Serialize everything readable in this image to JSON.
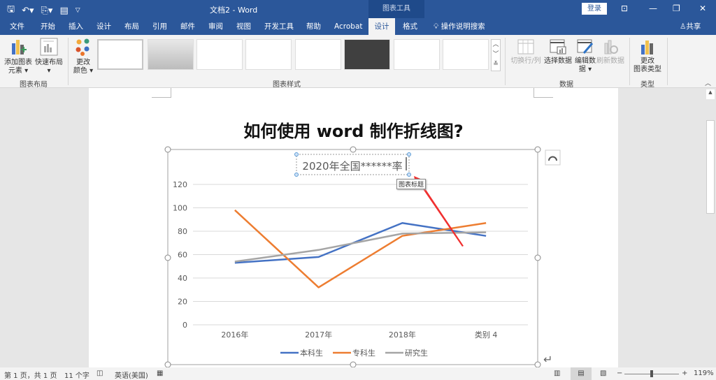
{
  "window": {
    "title": "文档2  -  Word",
    "context_tab_group": "图表工具",
    "login_label": "登录",
    "share_label": "共享"
  },
  "tabs": [
    {
      "label": "文件"
    },
    {
      "label": "开始"
    },
    {
      "label": "插入"
    },
    {
      "label": "设计"
    },
    {
      "label": "布局"
    },
    {
      "label": "引用"
    },
    {
      "label": "邮件"
    },
    {
      "label": "审阅"
    },
    {
      "label": "视图"
    },
    {
      "label": "开发工具"
    },
    {
      "label": "帮助"
    },
    {
      "label": "Acrobat"
    },
    {
      "label": "设计",
      "active": true
    },
    {
      "label": "格式"
    }
  ],
  "tell_me": "操作说明搜索",
  "ribbon": {
    "chart_layout": {
      "label": "图表布局",
      "add_element": "添加图表元素",
      "add_element_l1": "添加图表",
      "add_element_l2": "元素 ▾",
      "quick_layout_l1": "快速布局",
      "quick_layout_l2": "▾"
    },
    "chart_styles": {
      "label": "图表样式",
      "change_colors_l1": "更改",
      "change_colors_l2": "颜色 ▾"
    },
    "data": {
      "label": "数据",
      "switch_row_col": "切换行/列",
      "select_data": "选择数据",
      "edit_data_l1": "编辑数",
      "edit_data_l2": "据 ▾",
      "refresh_data": "刷新数据"
    },
    "type": {
      "label": "类型",
      "change_type_l1": "更改",
      "change_type_l2": "图表类型"
    }
  },
  "document": {
    "heading": "如何使用 word 制作折线图?",
    "tooltip": "图表标题"
  },
  "chart_data": {
    "type": "line",
    "title": "2020年全国******率",
    "categories": [
      "2016年",
      "2017年",
      "2018年",
      "类别 4"
    ],
    "series": [
      {
        "name": "本科生",
        "color": "#4472c4",
        "values": [
          53,
          58,
          87,
          76
        ]
      },
      {
        "name": "专科生",
        "color": "#ed7d31",
        "values": [
          98,
          32,
          76,
          87
        ]
      },
      {
        "name": "研究生",
        "color": "#a5a5a5",
        "values": [
          54,
          64,
          78,
          79
        ]
      }
    ],
    "ylim": [
      0,
      120
    ],
    "yticks": [
      "0",
      "20",
      "40",
      "60",
      "80",
      "100",
      "120"
    ],
    "grid": true,
    "legend": "bottom",
    "xlabel": "",
    "ylabel": ""
  },
  "status": {
    "page": "第 1 页，共 1 页",
    "words": "11 个字",
    "language": "英语(美国)",
    "zoom": "119%",
    "zoom_minus": "−",
    "zoom_plus": "+"
  }
}
